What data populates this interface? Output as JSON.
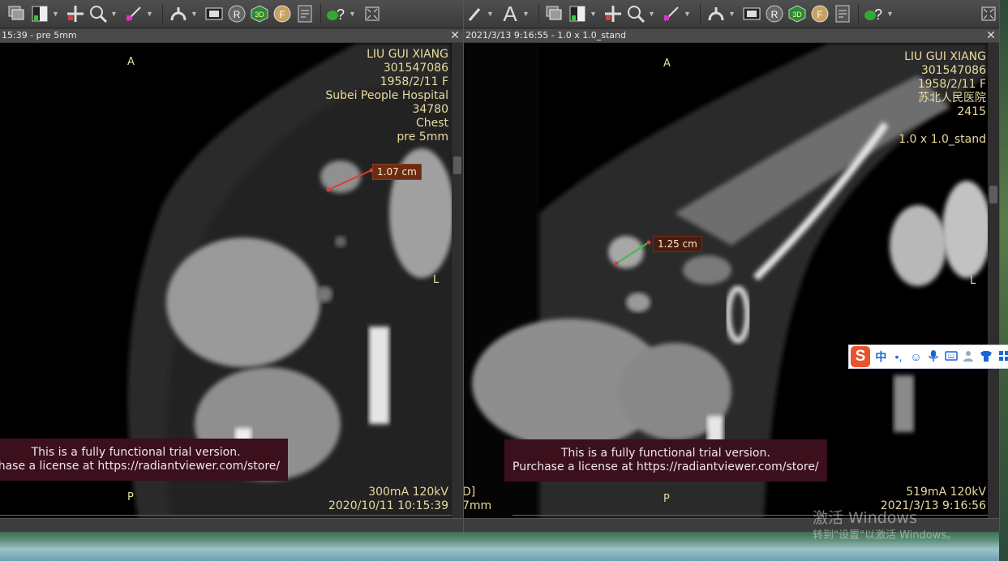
{
  "left_pane": {
    "title": "15:39 - pre  5mm",
    "patient_info": [
      "LIU GUI XIANG",
      "301547086",
      "1958/2/11 F",
      "Subei People Hospital",
      "34780",
      "Chest",
      "pre  5mm"
    ],
    "orientation": {
      "top": "A",
      "bottom": "P",
      "right": "L"
    },
    "measurement": "1.07 cm",
    "exposure": "300mA 120kV",
    "datetime": "2020/10/11 10:15:39",
    "trial_line1": "This is a fully functional trial version.",
    "trial_line2": "chase a license at https://radiantviewer.com/store/"
  },
  "right_pane": {
    "title": "2021/3/13 9:16:55 - 1.0 x 1.0_stand",
    "patient_info": [
      "LIU GUI XIANG",
      "301547086",
      "1958/2/11 F",
      "苏北人民医院",
      "2415"
    ],
    "series_label": "1.0 x 1.0_stand",
    "orientation": {
      "top": "A",
      "bottom": "P",
      "right": "L"
    },
    "measurement": "1.25 cm",
    "exposure": "519mA 120kV",
    "datetime": "2021/3/13 9:16:56",
    "left_edge_top": "D]",
    "left_edge_bottom": "7mm",
    "trial_line1": "This is a fully functional trial version.",
    "trial_line2": "Purchase a license at https://radiantviewer.com/store/"
  },
  "toolbar": {
    "text_tool_label": "A",
    "reset_tool_label": "R",
    "threed_tool_label": "3D",
    "fusion_tool_label": "F",
    "help_tool_label": "?"
  },
  "windows_watermark": {
    "line1": "激活 Windows",
    "line2": "转到\"设置\"以激活 Windows。"
  },
  "ime_bar": {
    "logo": "S",
    "mode": "中",
    "punct": "•,"
  },
  "colors": {
    "overlay_text": "#e8dba0",
    "measure_red": "#e23a3a",
    "measure_green": "#3bbf4c",
    "trial_bg": "#3b0f1c"
  }
}
